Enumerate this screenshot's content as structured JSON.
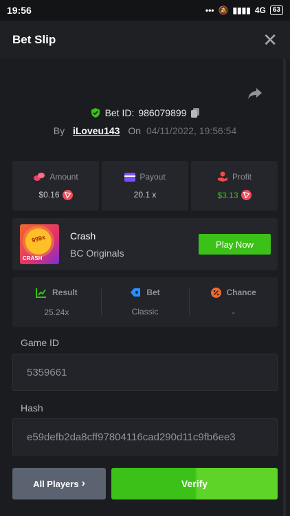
{
  "status": {
    "time": "19:56",
    "network": "4G",
    "battery": "63"
  },
  "header": {
    "title": "Bet Slip"
  },
  "bet": {
    "id_label": "Bet ID:",
    "id": "986079899",
    "by": "By",
    "user": "iLoveu143",
    "on": "On",
    "date": "04/11/2022, 19:56:54"
  },
  "stats": [
    {
      "label": "Amount",
      "value": "$0.16"
    },
    {
      "label": "Payout",
      "value": "20.1 x"
    },
    {
      "label": "Profit",
      "value": "$3.13"
    }
  ],
  "game": {
    "name": "Crash",
    "provider": "BC Originals",
    "thumb_text": "CRASH",
    "thumb_badge": "999x",
    "play_label": "Play Now"
  },
  "result": [
    {
      "label": "Result",
      "value": "25.24x"
    },
    {
      "label": "Bet",
      "value": "Classic"
    },
    {
      "label": "Chance",
      "value": "-"
    }
  ],
  "fields": {
    "game_id_label": "Game ID",
    "game_id": "5359661",
    "hash_label": "Hash",
    "hash": "e59defb2da8cff97804116cad290d11c9fb6ee3"
  },
  "actions": {
    "players": "All Players",
    "players_arrow": "›",
    "verify": "Verify"
  },
  "colors": {
    "green": "#3bc117",
    "coin": "#ef4d5d",
    "bg": "#1a1c1f"
  }
}
